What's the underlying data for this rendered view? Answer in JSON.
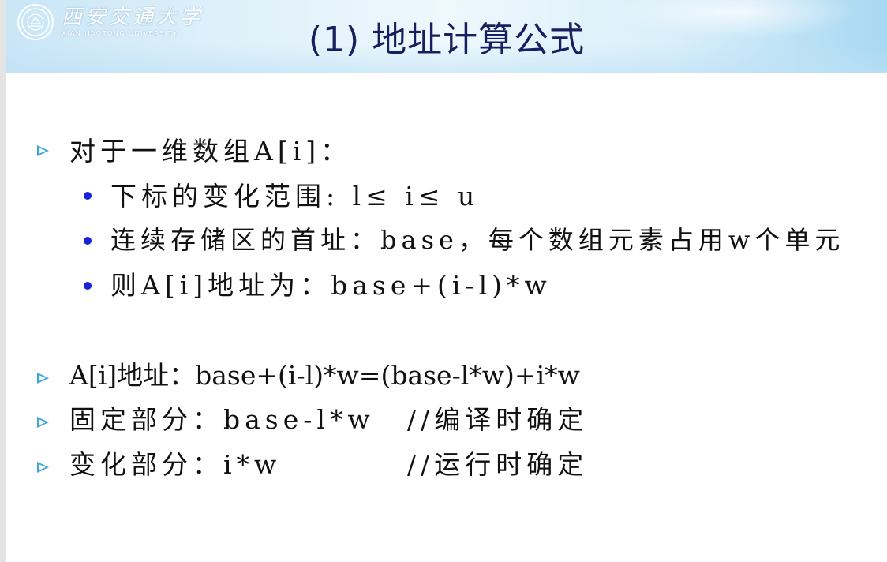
{
  "header": {
    "logo": {
      "name_cn": "西安交通大学",
      "name_en": "XIAN JIAOTONG UNIVERSITY"
    },
    "title": "(1) 地址计算公式"
  },
  "bullets_top": {
    "item1": "对于一维数组A[i]：",
    "sub": [
      "下标的变化范围: l≤ i≤ u",
      "连续存储区的首址：base，每个数组元素占用w个单元",
      "则A[i]地址为：base+(i-l)*w"
    ]
  },
  "bullets_bottom": [
    {
      "text": "A[i]地址：base+(i-l)*w=(base-l*w)+i*w",
      "comment": ""
    },
    {
      "text": "固定部分：base-l*w",
      "comment": "//编译时确定"
    },
    {
      "text": "变化部分：i*w",
      "comment": "//运行时确定"
    }
  ],
  "colors": {
    "title": "#17205f",
    "arrow": "#3aa7d8",
    "dot": "#1a22d8",
    "header_bg": "#c9e6f7"
  },
  "icons": {
    "bullet_arrow": "arrow-bullet-icon",
    "sub_bullet": "dot-bullet-icon",
    "logo": "university-seal-icon"
  }
}
